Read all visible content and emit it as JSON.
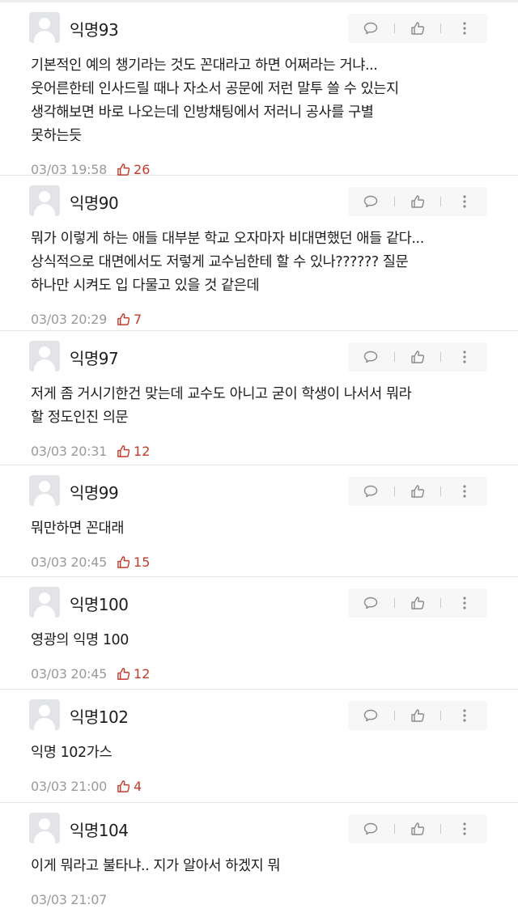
{
  "colors": {
    "like": "#c43a2c",
    "meta": "#9a9a9a",
    "divider": "#e6e6e6"
  },
  "icons": {
    "reply": "speech-bubble-icon",
    "like": "thumbs-up-icon",
    "more": "more-vertical-icon",
    "avatar": "default-avatar-icon"
  },
  "comments": [
    {
      "nickname": "익명93",
      "text": "기본적인 예의 챙기라는 것도 꼰대라고 하면 어쩌라는 거냐...\n웃어른한테 인사드릴 때나 자소서 공문에 저런 말투 쓸 수 있는지\n생각해보면 바로 나오는데 인방채팅에서 저러니 공사를 구별\n못하는듯",
      "date": "03/03 19:58",
      "likes": "26"
    },
    {
      "nickname": "익명90",
      "text": "뭐가 이렇게 하는 애들 대부분 학교 오자마자 비대면했던 애들 같다...\n상식적으로 대면에서도 저렇게 교수님한테 할 수 있나?????? 질문\n하나만 시켜도 입 다물고 있을 것 같은데",
      "date": "03/03 20:29",
      "likes": "7"
    },
    {
      "nickname": "익명97",
      "text": "저게 좀 거시기한건 맞는데 교수도 아니고 굳이 학생이 나서서 뭐라\n할 정도인진 의문",
      "date": "03/03 20:31",
      "likes": "12"
    },
    {
      "nickname": "익명99",
      "text": "뭐만하면 꼰대래",
      "date": "03/03 20:45",
      "likes": "15"
    },
    {
      "nickname": "익명100",
      "text": "영광의 익명 100",
      "date": "03/03 20:45",
      "likes": "12"
    },
    {
      "nickname": "익명102",
      "text": "익명 102가스",
      "date": "03/03 21:00",
      "likes": "4"
    },
    {
      "nickname": "익명104",
      "text": "이게 뭐라고 불타냐.. 지가 알아서 하겠지 뭐",
      "date": "03/03 21:07",
      "likes": ""
    }
  ]
}
